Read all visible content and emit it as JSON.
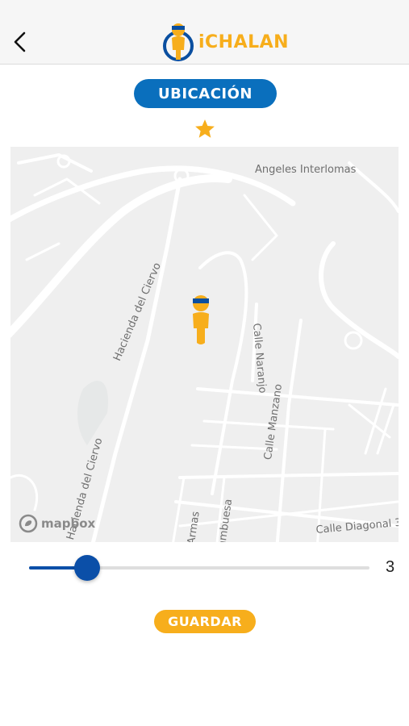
{
  "app": {
    "logo_text": "iCHALAN"
  },
  "nav": {
    "back_icon": "chevron-left-icon"
  },
  "location_button": {
    "label": "UBICACIÓN"
  },
  "favorite": {
    "icon": "star-icon",
    "color": "#f7ae1c"
  },
  "map": {
    "labels": {
      "angeles": "Angeles Interlomas",
      "hacienda_ciervo_1": "Hacienda del Ciervo",
      "hacienda_ciervo_2": "Hacienda del Ciervo",
      "calle_naranjo": "Calle Naranjo",
      "calle_manzano": "Calle Manzano",
      "calle_diagonal": "Calle Diagonal 3",
      "armas": "Armas",
      "frambuesa": "ambuesa"
    },
    "attribution": "mapbox",
    "pin_icon": "person-pin-icon"
  },
  "slider": {
    "value": 3,
    "fill_fraction": 0.17
  },
  "save_button": {
    "label": "GUARDAR"
  },
  "colors": {
    "primary_blue": "#0a6fbd",
    "accent_yellow": "#f7ae1c",
    "slider_blue": "#0b4fa8"
  }
}
